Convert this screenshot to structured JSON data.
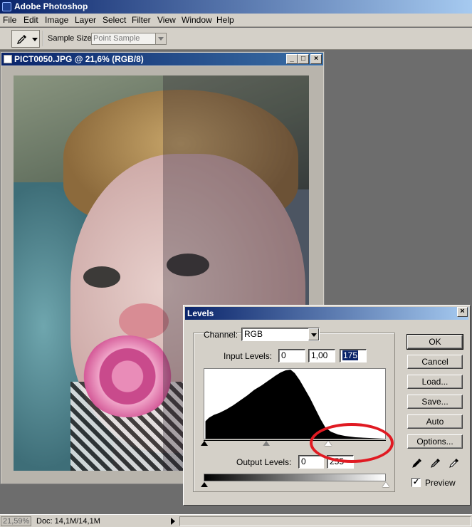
{
  "app": {
    "title": "Adobe Photoshop"
  },
  "menu": [
    "File",
    "Edit",
    "Image",
    "Layer",
    "Select",
    "Filter",
    "View",
    "Window",
    "Help"
  ],
  "options": {
    "sample_size_label": "Sample Size:",
    "sample_size_value": "Point Sample"
  },
  "document": {
    "title": "PICT0050.JPG @ 21,6% (RGB/8)"
  },
  "status": {
    "zoom": "21,59%",
    "doc_size": "Doc: 14,1M/14,1M"
  },
  "levels": {
    "title": "Levels",
    "channel_label": "Channel:",
    "channel_value": "RGB",
    "input_label": "Input Levels:",
    "input_black": "0",
    "input_gamma": "1,00",
    "input_white": "175",
    "output_label": "Output Levels:",
    "output_black": "0",
    "output_white": "255",
    "buttons": [
      "OK",
      "Cancel",
      "Load...",
      "Save...",
      "Auto",
      "Options..."
    ],
    "preview_label": "Preview",
    "preview_checked": true
  },
  "colors": {
    "titlebar": "#0a246a",
    "annotation": "#e01a22"
  }
}
